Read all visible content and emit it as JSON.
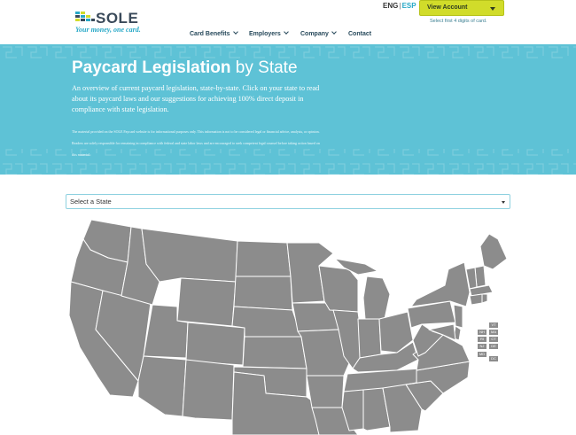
{
  "brand": {
    "name": "SOLE",
    "tagline": "Your money, one card.",
    "mark_colors": [
      "#27a8c7",
      "#d1dc2a",
      "#3a4a5a"
    ]
  },
  "header": {
    "lang_en": "ENG",
    "lang_sep": "|",
    "lang_es": "ESP",
    "account_button": "View Account",
    "account_hint": "Select first 4 digits of card."
  },
  "nav": {
    "items": [
      {
        "label": "Card Benefits",
        "has_dropdown": true
      },
      {
        "label": "Employers",
        "has_dropdown": true
      },
      {
        "label": "Company",
        "has_dropdown": true
      },
      {
        "label": "Contact",
        "has_dropdown": false
      }
    ]
  },
  "hero": {
    "title_strong": "Paycard Legislation",
    "title_light": "by State",
    "intro": "An overview of current paycard legislation, state-by-state. Click on your state to read about its paycard laws and our suggestions for achieving 100% direct deposit in compliance with state legislation.",
    "disclaimer": "The material provided on the SOLE Paycard website is for informational purposes only. This information is not to be considered legal or financial advice, analysis, or opinion. Readers are solely responsible for remaining in compliance with federal and state labor laws and are encouraged to seek competent legal counsel before taking action based on this material.",
    "background_color": "#5ec2d6"
  },
  "state_select": {
    "value": "Select a State"
  },
  "map": {
    "fill_color": "#8c8c8c",
    "border_color": "#ffffff",
    "small_states": [
      "VT",
      "NH",
      "MA",
      "RI",
      "CT",
      "NJ",
      "DE",
      "MD",
      "DC"
    ]
  }
}
